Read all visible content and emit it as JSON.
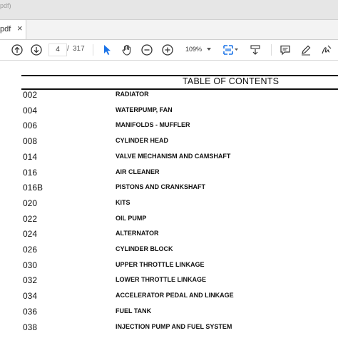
{
  "window": {
    "title_fragment": "pdf)"
  },
  "tab": {
    "label": "pdf",
    "close_glyph": "×"
  },
  "toolbar": {
    "prev_page": "arrow-up-icon",
    "next_page": "arrow-down-icon",
    "current_page": "4",
    "page_separator": "/",
    "total_pages": "317",
    "zoom": "109%",
    "accent": "#1a73e8"
  },
  "toc": {
    "heading": "TABLE OF CONTENTS",
    "entries": [
      {
        "code": "002",
        "title": "RADIATOR"
      },
      {
        "code": "004",
        "title": "WATERPUMP, FAN"
      },
      {
        "code": "006",
        "title": "MANIFOLDS - MUFFLER"
      },
      {
        "code": "008",
        "title": "CYLINDER HEAD"
      },
      {
        "code": "014",
        "title": "VALVE MECHANISM AND CAMSHAFT"
      },
      {
        "code": "016",
        "title": "AIR CLEANER"
      },
      {
        "code": "016B",
        "title": "PISTONS AND CRANKSHAFT"
      },
      {
        "code": "020",
        "title": "KITS"
      },
      {
        "code": "022",
        "title": "OIL PUMP"
      },
      {
        "code": "024",
        "title": "ALTERNATOR"
      },
      {
        "code": "026",
        "title": "CYLINDER BLOCK"
      },
      {
        "code": "030",
        "title": "UPPER THROTTLE LINKAGE"
      },
      {
        "code": "032",
        "title": "LOWER THROTTLE LINKAGE"
      },
      {
        "code": "034",
        "title": "ACCELERATOR PEDAL AND LINKAGE"
      },
      {
        "code": "036",
        "title": "FUEL TANK"
      },
      {
        "code": "038",
        "title": "INJECTION PUMP AND FUEL SYSTEM"
      }
    ]
  }
}
